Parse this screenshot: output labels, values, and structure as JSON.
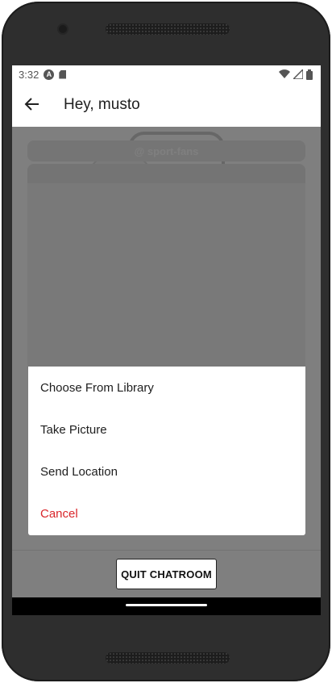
{
  "status_bar": {
    "time": "3:32",
    "badge_letter": "A",
    "icons": [
      "wifi-icon",
      "signal-icon",
      "battery-icon"
    ]
  },
  "app_bar": {
    "title": "Hey, musto",
    "back_icon": "arrow-left-icon"
  },
  "chatroom": {
    "name": "@ sport-fans"
  },
  "action_sheet": {
    "options": [
      {
        "label": "Choose From Library"
      },
      {
        "label": "Take Picture"
      },
      {
        "label": "Send Location"
      },
      {
        "label": "Cancel"
      }
    ]
  },
  "footer": {
    "quit_label": "QUIT CHATROOM"
  },
  "colors": {
    "cancel": "#d9262b",
    "overlay": "rgba(0,0,0,0.5)"
  }
}
